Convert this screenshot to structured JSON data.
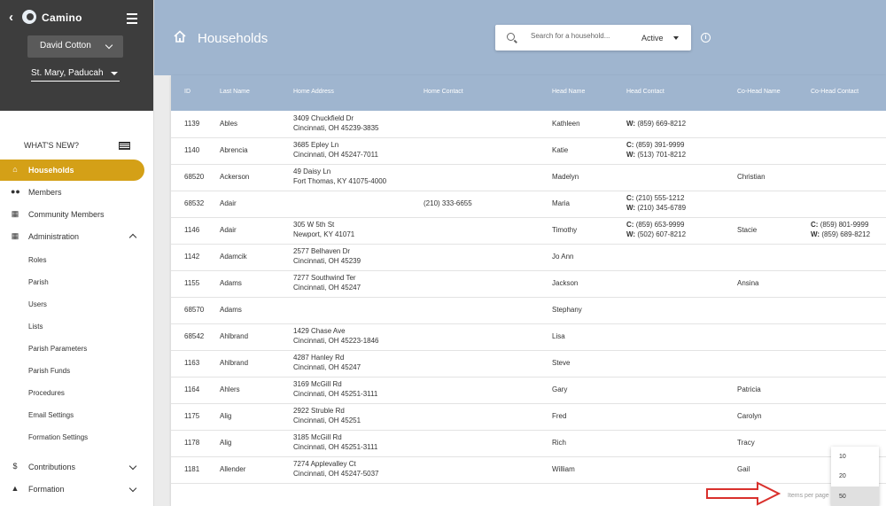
{
  "app": {
    "name": "Camino"
  },
  "sidebar": {
    "user": "David Cotton",
    "parish": "St. Mary, Paducah",
    "whats_new": "WHAT'S NEW?",
    "items": [
      {
        "label": "Households",
        "icon": "home-icon"
      },
      {
        "label": "Members",
        "icon": "people-icon"
      },
      {
        "label": "Community Members",
        "icon": "building-icon"
      },
      {
        "label": "Administration",
        "icon": "grid-icon"
      },
      {
        "label": "Contributions",
        "icon": "dollar-icon"
      },
      {
        "label": "Formation",
        "icon": "graduation-cap-icon"
      }
    ],
    "admin_subitems": [
      "Roles",
      "Parish",
      "Users",
      "Lists",
      "Parish Parameters",
      "Parish Funds",
      "Procedures",
      "Email Settings",
      "Formation Settings"
    ]
  },
  "header": {
    "title": "Households",
    "search_placeholder": "Search for a household...",
    "status": "Active"
  },
  "table": {
    "columns": [
      "ID",
      "Last Name",
      "Home Address",
      "Home Contact",
      "Head Name",
      "Head Contact",
      "Co-Head Name",
      "Co-Head Contact"
    ],
    "rows": [
      {
        "id": "1139",
        "last": "Ables",
        "addr1": "3409 Chuckfield Dr",
        "addr2": "Cincinnati, OH 45239-3835",
        "home": "",
        "head": "Kathleen",
        "hc1_t": "W:",
        "hc1": "(859) 669-8212",
        "hc2_t": "",
        "hc2": "",
        "cohead": "",
        "cc1_t": "",
        "cc1": "",
        "cc2_t": "",
        "cc2": ""
      },
      {
        "id": "1140",
        "last": "Abrencia",
        "addr1": "3685 Epley Ln",
        "addr2": "Cincinnati, OH 45247-7011",
        "home": "",
        "head": "Katie",
        "hc1_t": "C:",
        "hc1": "(859) 391-9999",
        "hc2_t": "W:",
        "hc2": "(513) 701-8212",
        "cohead": "",
        "cc1_t": "",
        "cc1": "",
        "cc2_t": "",
        "cc2": ""
      },
      {
        "id": "68520",
        "last": "Ackerson",
        "addr1": "49 Daisy Ln",
        "addr2": "Fort Thomas, KY 41075-4000",
        "home": "",
        "head": "Madelyn",
        "hc1_t": "",
        "hc1": "",
        "hc2_t": "",
        "hc2": "",
        "cohead": "Christian",
        "cc1_t": "",
        "cc1": "",
        "cc2_t": "",
        "cc2": ""
      },
      {
        "id": "68532",
        "last": "Adair",
        "addr1": "",
        "addr2": "",
        "home": "(210) 333-6655",
        "head": "Maria",
        "hc1_t": "C:",
        "hc1": "(210) 555-1212",
        "hc2_t": "W:",
        "hc2": "(210) 345-6789",
        "cohead": "",
        "cc1_t": "",
        "cc1": "",
        "cc2_t": "",
        "cc2": ""
      },
      {
        "id": "1146",
        "last": "Adair",
        "addr1": "305 W 5th St",
        "addr2": "Newport, KY 41071",
        "home": "",
        "head": "Timothy",
        "hc1_t": "C:",
        "hc1": "(859) 653-9999",
        "hc2_t": "W:",
        "hc2": "(502) 607-8212",
        "cohead": "Stacie",
        "cc1_t": "C:",
        "cc1": "(859) 801-9999",
        "cc2_t": "W:",
        "cc2": "(859) 689-8212"
      },
      {
        "id": "1142",
        "last": "Adamcik",
        "addr1": "2577 Belhaven Dr",
        "addr2": "Cincinnati, OH 45239",
        "home": "",
        "head": "Jo Ann",
        "hc1_t": "",
        "hc1": "",
        "hc2_t": "",
        "hc2": "",
        "cohead": "",
        "cc1_t": "",
        "cc1": "",
        "cc2_t": "",
        "cc2": ""
      },
      {
        "id": "1155",
        "last": "Adams",
        "addr1": "7277 Southwind Ter",
        "addr2": "Cincinnati, OH 45247",
        "home": "",
        "head": "Jackson",
        "hc1_t": "",
        "hc1": "",
        "hc2_t": "",
        "hc2": "",
        "cohead": "Ansina",
        "cc1_t": "",
        "cc1": "",
        "cc2_t": "",
        "cc2": ""
      },
      {
        "id": "68570",
        "last": "Adams",
        "addr1": "",
        "addr2": "",
        "home": "",
        "head": "Stephany",
        "hc1_t": "",
        "hc1": "",
        "hc2_t": "",
        "hc2": "",
        "cohead": "",
        "cc1_t": "",
        "cc1": "",
        "cc2_t": "",
        "cc2": ""
      },
      {
        "id": "68542",
        "last": "Ahlbrand",
        "addr1": "1429 Chase Ave",
        "addr2": "Cincinnati, OH 45223-1846",
        "home": "",
        "head": "Lisa",
        "hc1_t": "",
        "hc1": "",
        "hc2_t": "",
        "hc2": "",
        "cohead": "",
        "cc1_t": "",
        "cc1": "",
        "cc2_t": "",
        "cc2": ""
      },
      {
        "id": "1163",
        "last": "Ahlbrand",
        "addr1": "4287 Hanley Rd",
        "addr2": "Cincinnati, OH 45247",
        "home": "",
        "head": "Steve",
        "hc1_t": "",
        "hc1": "",
        "hc2_t": "",
        "hc2": "",
        "cohead": "",
        "cc1_t": "",
        "cc1": "",
        "cc2_t": "",
        "cc2": ""
      },
      {
        "id": "1164",
        "last": "Ahlers",
        "addr1": "3169 McGill Rd",
        "addr2": "Cincinnati, OH 45251-3111",
        "home": "",
        "head": "Gary",
        "hc1_t": "",
        "hc1": "",
        "hc2_t": "",
        "hc2": "",
        "cohead": "Patricia",
        "cc1_t": "",
        "cc1": "",
        "cc2_t": "",
        "cc2": ""
      },
      {
        "id": "1175",
        "last": "Alig",
        "addr1": "2922 Struble Rd",
        "addr2": "Cincinnati, OH 45251",
        "home": "",
        "head": "Fred",
        "hc1_t": "",
        "hc1": "",
        "hc2_t": "",
        "hc2": "",
        "cohead": "Carolyn",
        "cc1_t": "",
        "cc1": "",
        "cc2_t": "",
        "cc2": ""
      },
      {
        "id": "1178",
        "last": "Alig",
        "addr1": "3185 McGill Rd",
        "addr2": "Cincinnati, OH 45251-3111",
        "home": "",
        "head": "Rich",
        "hc1_t": "",
        "hc1": "",
        "hc2_t": "",
        "hc2": "",
        "cohead": "Tracy",
        "cc1_t": "",
        "cc1": "",
        "cc2_t": "",
        "cc2": ""
      },
      {
        "id": "1181",
        "last": "Allender",
        "addr1": "7274 Applevalley Ct",
        "addr2": "Cincinnati, OH 45247-5037",
        "home": "",
        "head": "William",
        "hc1_t": "",
        "hc1": "",
        "hc2_t": "",
        "hc2": "",
        "cohead": "Gail",
        "cc1_t": "",
        "cc1": "",
        "cc2_t": "",
        "cc2": ""
      }
    ]
  },
  "pagination": {
    "items_per_page_label": "Items per page",
    "options": [
      "10",
      "20",
      "50"
    ],
    "selected": "50"
  },
  "colors": {
    "header": "#9fb5cf",
    "active_nav": "#d4a017",
    "sidebar_dark": "#3d3d3d",
    "annotation_arrow": "#d9302c"
  }
}
